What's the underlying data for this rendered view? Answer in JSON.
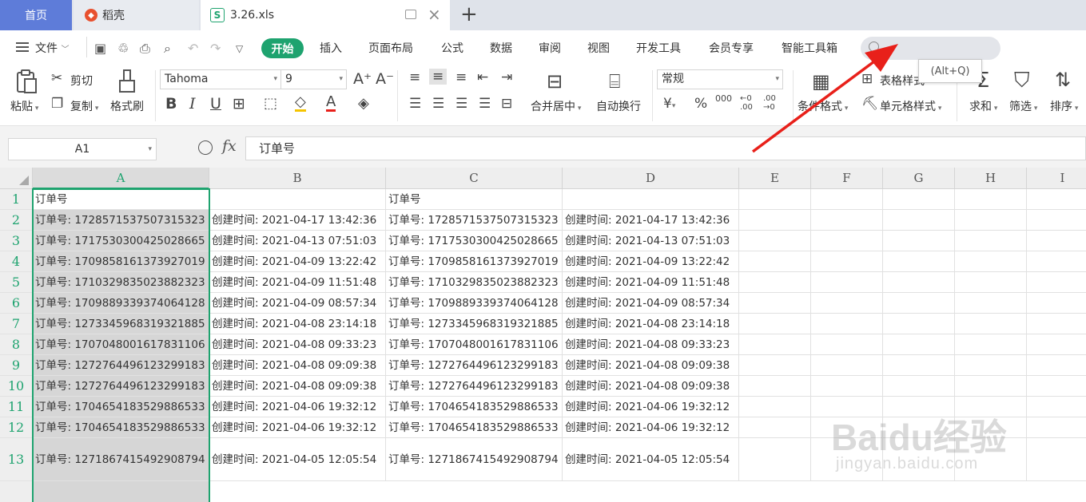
{
  "tabs": {
    "home": "首页",
    "daoke": "稻壳",
    "file": "3.26.xls",
    "file_icon": "S"
  },
  "menu": {
    "file": "文件",
    "start": "开始",
    "items": [
      "插入",
      "页面布局",
      "公式",
      "数据",
      "审阅",
      "视图",
      "开发工具",
      "会员专享",
      "智能工具箱"
    ],
    "search_placeholder": "",
    "tooltip": "(Alt+Q)"
  },
  "ribbon": {
    "paste": "粘贴",
    "cut": "剪切",
    "copy": "复制",
    "format_painter": "格式刷",
    "font_name": "Tahoma",
    "font_size": "9",
    "merge": "合并居中",
    "wrap": "自动换行",
    "number_format": "常规",
    "cond_format": "条件格式",
    "table_style": "表格样式",
    "cell_style": "单元格样式",
    "sum": "求和",
    "filter": "筛选",
    "sort": "排序"
  },
  "formula_bar": {
    "name_box": "A1",
    "fx": "fx",
    "content": "订单号"
  },
  "sheet": {
    "columns": [
      "A",
      "B",
      "C",
      "D",
      "E",
      "F",
      "G",
      "H",
      "I"
    ],
    "rows": [
      {
        "n": "1",
        "a": "订单号",
        "b": "",
        "c": "订单号",
        "d": ""
      },
      {
        "n": "2",
        "a": "订单号: 1728571537507315323",
        "b": "创建时间: 2021-04-17 13:42:36",
        "c": "订单号: 1728571537507315323",
        "d": "创建时间: 2021-04-17 13:42:36"
      },
      {
        "n": "3",
        "a": "订单号: 1717530300425028665",
        "b": "创建时间: 2021-04-13 07:51:03",
        "c": "订单号: 1717530300425028665",
        "d": "创建时间: 2021-04-13 07:51:03"
      },
      {
        "n": "4",
        "a": "订单号: 1709858161373927019",
        "b": "创建时间: 2021-04-09 13:22:42",
        "c": "订单号: 1709858161373927019",
        "d": "创建时间: 2021-04-09 13:22:42"
      },
      {
        "n": "5",
        "a": "订单号: 1710329835023882323",
        "b": "创建时间: 2021-04-09 11:51:48",
        "c": "订单号: 1710329835023882323",
        "d": "创建时间: 2021-04-09 11:51:48"
      },
      {
        "n": "6",
        "a": "订单号: 1709889339374064128",
        "b": "创建时间: 2021-04-09 08:57:34",
        "c": "订单号: 1709889339374064128",
        "d": "创建时间: 2021-04-09 08:57:34"
      },
      {
        "n": "7",
        "a": "订单号: 1273345968319321885",
        "b": "创建时间: 2021-04-08 23:14:18",
        "c": "订单号: 1273345968319321885",
        "d": "创建时间: 2021-04-08 23:14:18"
      },
      {
        "n": "8",
        "a": "订单号: 1707048001617831106",
        "b": "创建时间: 2021-04-08 09:33:23",
        "c": "订单号: 1707048001617831106",
        "d": "创建时间: 2021-04-08 09:33:23"
      },
      {
        "n": "9",
        "a": "订单号: 1272764496123299183",
        "b": "创建时间: 2021-04-08 09:09:38",
        "c": "订单号: 1272764496123299183",
        "d": "创建时间: 2021-04-08 09:09:38"
      },
      {
        "n": "10",
        "a": "订单号: 1272764496123299183",
        "b": "创建时间: 2021-04-08 09:09:38",
        "c": "订单号: 1272764496123299183",
        "d": "创建时间: 2021-04-08 09:09:38"
      },
      {
        "n": "11",
        "a": "订单号: 1704654183529886533",
        "b": "创建时间: 2021-04-06 19:32:12",
        "c": "订单号: 1704654183529886533",
        "d": "创建时间: 2021-04-06 19:32:12"
      },
      {
        "n": "12",
        "a": "订单号: 1704654183529886533",
        "b": "创建时间: 2021-04-06 19:32:12",
        "c": "订单号: 1704654183529886533",
        "d": "创建时间: 2021-04-06 19:32:12"
      },
      {
        "n": "13",
        "a": "订单号: 1271867415492908794",
        "b": "创建时间: 2021-04-05 12:05:54",
        "c": "订单号: 1271867415492908794",
        "d": "创建时间: 2021-04-05 12:05:54"
      }
    ]
  },
  "watermark": {
    "brand": "Baidu经验",
    "url": "jingyan.baidu.com"
  },
  "colors": {
    "accent": "#1ea36f",
    "home_tab": "#5e7cd9",
    "annotation_arrow": "#e8201a"
  }
}
